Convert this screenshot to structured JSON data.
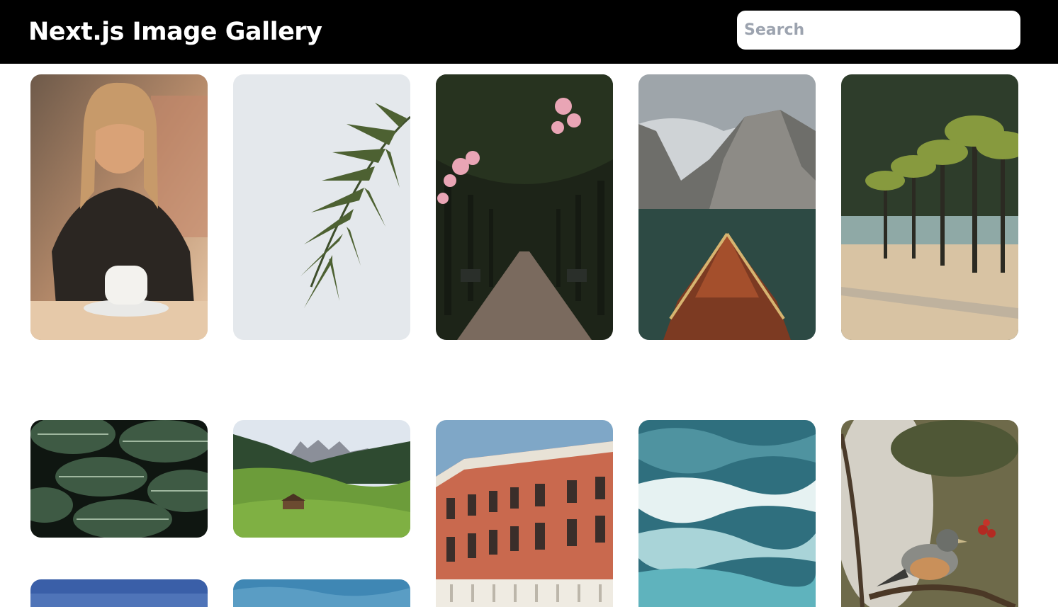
{
  "header": {
    "title": "Next.js Image Gallery",
    "search_placeholder": "Search",
    "search_value": ""
  },
  "colors": {
    "header_bg": "#000000",
    "title_color": "#ffffff",
    "page_bg": "#ffffff"
  },
  "gallery": {
    "images": [
      {
        "name": "woman-with-coffee-photo"
      },
      {
        "name": "palm-leaves-sky-photo"
      },
      {
        "name": "tree-lined-path-photo"
      },
      {
        "name": "mountain-lake-boat-photo"
      },
      {
        "name": "palm-promenade-photo"
      },
      {
        "name": "monstera-leaves-photo"
      },
      {
        "name": "alpine-valley-photo"
      },
      {
        "name": "venetian-palace-photo"
      },
      {
        "name": "ocean-waves-photo"
      },
      {
        "name": "bird-on-branch-photo"
      },
      {
        "name": "blue-sky-photo"
      },
      {
        "name": "blue-water-photo"
      }
    ]
  }
}
